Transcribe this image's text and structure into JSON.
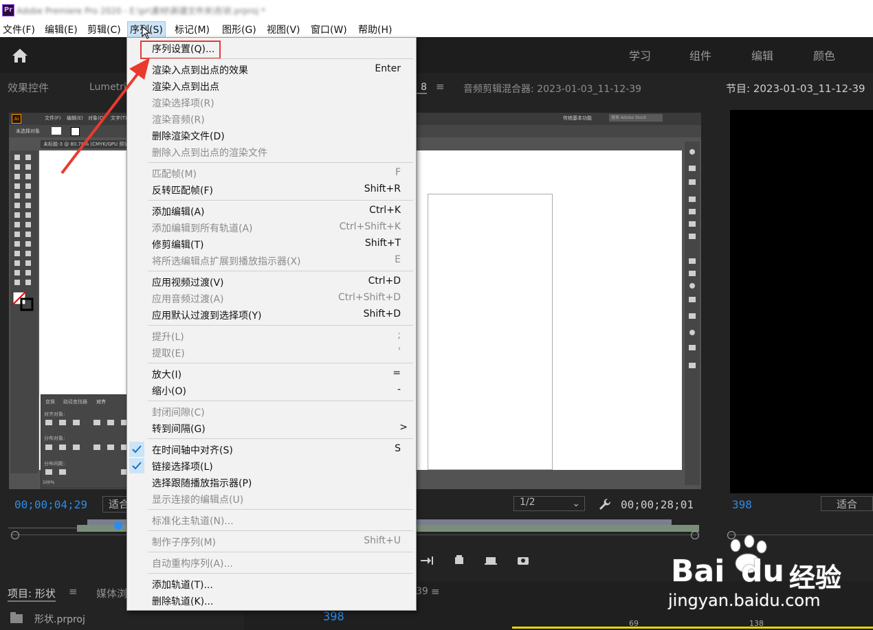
{
  "titlebar": {
    "app_abbr": "Pr",
    "title": "Adobe Premiere Pro 2020 - E:\\pr\\素材\\新建文件夹\\形状.prproj *"
  },
  "menubar": {
    "items": [
      {
        "label": "文件(F)"
      },
      {
        "label": "编辑(E)"
      },
      {
        "label": "剪辑(C)"
      },
      {
        "label": "序列(S)"
      },
      {
        "label": "标记(M)"
      },
      {
        "label": "图形(G)"
      },
      {
        "label": "视图(V)"
      },
      {
        "label": "窗口(W)"
      },
      {
        "label": "帮助(H)"
      }
    ],
    "active_index": 3
  },
  "workspace": {
    "tabs": [
      {
        "label": "学习"
      },
      {
        "label": "组件"
      },
      {
        "label": "编辑"
      },
      {
        "label": "颜色"
      }
    ]
  },
  "source_panel": {
    "tab1": "效果控件",
    "tab2": "Lumetri",
    "tab3_partial": ": 8",
    "tab4": "音频剪辑混合器: 2023-01-03_11-12-39",
    "timecode": "00;00;04;29",
    "fit_label": "适合",
    "fraction": "1/2",
    "duration": "00;00;28;01"
  },
  "program_panel": {
    "title": "节目: 2023-01-03_11-12-39",
    "frame_value": "398",
    "fit_label": "适合"
  },
  "project_panel": {
    "tab1": "项目: 形状",
    "tab2": "媒体浏",
    "project_file": "形状.prproj"
  },
  "timeline_panel": {
    "tab_partial": "39",
    "frame_value": "398",
    "ruler_69": "69",
    "ruler_138": "138"
  },
  "embedded": {
    "ai_menu": [
      "文件(F)",
      "编辑(E)",
      "对象(O)",
      "文字(T)"
    ],
    "workspace_label": "传统基本功能",
    "search_placeholder": "搜索 Adobe Stock",
    "no_selection": "未选择对象",
    "doc_tab": "未标题-3 @ 80.78% (CMYK/GPU 预览)",
    "align_tabs": [
      "变换",
      "路径查找器",
      "对齐"
    ],
    "align_label1": "对齐对象:",
    "align_label2": "分布对象:",
    "align_label3": "分布间距:",
    "zoom": "100%"
  },
  "dropdown": {
    "highlight_index": 0,
    "items": [
      {
        "label": "序列设置(Q)...",
        "shortcut": "",
        "disabled": false,
        "checked": false,
        "sep_before": false
      },
      {
        "label": "渲染入点到出点的效果",
        "shortcut": "Enter",
        "disabled": false,
        "checked": false,
        "sep_before": true
      },
      {
        "label": "渲染入点到出点",
        "shortcut": "",
        "disabled": false,
        "checked": false,
        "sep_before": false
      },
      {
        "label": "渲染选择项(R)",
        "shortcut": "",
        "disabled": true,
        "checked": false,
        "sep_before": false
      },
      {
        "label": "渲染音频(R)",
        "shortcut": "",
        "disabled": true,
        "checked": false,
        "sep_before": false
      },
      {
        "label": "删除渲染文件(D)",
        "shortcut": "",
        "disabled": false,
        "checked": false,
        "sep_before": false
      },
      {
        "label": "删除入点到出点的渲染文件",
        "shortcut": "",
        "disabled": true,
        "checked": false,
        "sep_before": false
      },
      {
        "label": "匹配帧(M)",
        "shortcut": "F",
        "disabled": true,
        "checked": false,
        "sep_before": true
      },
      {
        "label": "反转匹配帧(F)",
        "shortcut": "Shift+R",
        "disabled": false,
        "checked": false,
        "sep_before": false
      },
      {
        "label": "添加编辑(A)",
        "shortcut": "Ctrl+K",
        "disabled": false,
        "checked": false,
        "sep_before": true
      },
      {
        "label": "添加编辑到所有轨道(A)",
        "shortcut": "Ctrl+Shift+K",
        "disabled": true,
        "checked": false,
        "sep_before": false
      },
      {
        "label": "修剪编辑(T)",
        "shortcut": "Shift+T",
        "disabled": false,
        "checked": false,
        "sep_before": false
      },
      {
        "label": "将所选编辑点扩展到播放指示器(X)",
        "shortcut": "E",
        "disabled": true,
        "checked": false,
        "sep_before": false
      },
      {
        "label": "应用视频过渡(V)",
        "shortcut": "Ctrl+D",
        "disabled": false,
        "checked": false,
        "sep_before": true
      },
      {
        "label": "应用音频过渡(A)",
        "shortcut": "Ctrl+Shift+D",
        "disabled": true,
        "checked": false,
        "sep_before": false
      },
      {
        "label": "应用默认过渡到选择项(Y)",
        "shortcut": "Shift+D",
        "disabled": false,
        "checked": false,
        "sep_before": false
      },
      {
        "label": "提升(L)",
        "shortcut": ";",
        "disabled": true,
        "checked": false,
        "sep_before": true
      },
      {
        "label": "提取(E)",
        "shortcut": "'",
        "disabled": true,
        "checked": false,
        "sep_before": false
      },
      {
        "label": "放大(I)",
        "shortcut": "=",
        "disabled": false,
        "checked": false,
        "sep_before": true
      },
      {
        "label": "缩小(O)",
        "shortcut": "-",
        "disabled": false,
        "checked": false,
        "sep_before": false
      },
      {
        "label": "封闭间隙(C)",
        "shortcut": "",
        "disabled": true,
        "checked": false,
        "sep_before": true
      },
      {
        "label": "转到间隔(G)",
        "shortcut": ">",
        "disabled": false,
        "checked": false,
        "sep_before": false
      },
      {
        "label": "在时间轴中对齐(S)",
        "shortcut": "S",
        "disabled": false,
        "checked": true,
        "sep_before": true
      },
      {
        "label": "链接选择项(L)",
        "shortcut": "",
        "disabled": false,
        "checked": true,
        "sep_before": false
      },
      {
        "label": "选择跟随播放指示器(P)",
        "shortcut": "",
        "disabled": false,
        "checked": false,
        "sep_before": false
      },
      {
        "label": "显示连接的编辑点(U)",
        "shortcut": "",
        "disabled": true,
        "checked": false,
        "sep_before": false
      },
      {
        "label": "标准化主轨道(N)...",
        "shortcut": "",
        "disabled": true,
        "checked": false,
        "sep_before": true
      },
      {
        "label": "制作子序列(M)",
        "shortcut": "Shift+U",
        "disabled": true,
        "checked": false,
        "sep_before": true
      },
      {
        "label": "自动重构序列(A)...",
        "shortcut": "",
        "disabled": true,
        "checked": false,
        "sep_before": true
      },
      {
        "label": "添加轨道(T)...",
        "shortcut": "",
        "disabled": false,
        "checked": false,
        "sep_before": true
      },
      {
        "label": "删除轨道(K)...",
        "shortcut": "",
        "disabled": false,
        "checked": false,
        "sep_before": false
      }
    ]
  },
  "watermark": {
    "brand": "Bai",
    "brand_du": "du",
    "brand_cn": "经验",
    "url": "jingyan.baidu.com"
  },
  "colors": {
    "accent_blue": "#2d8ceb",
    "highlight_red": "#e53935",
    "menu_bg": "#f2f2f2"
  }
}
